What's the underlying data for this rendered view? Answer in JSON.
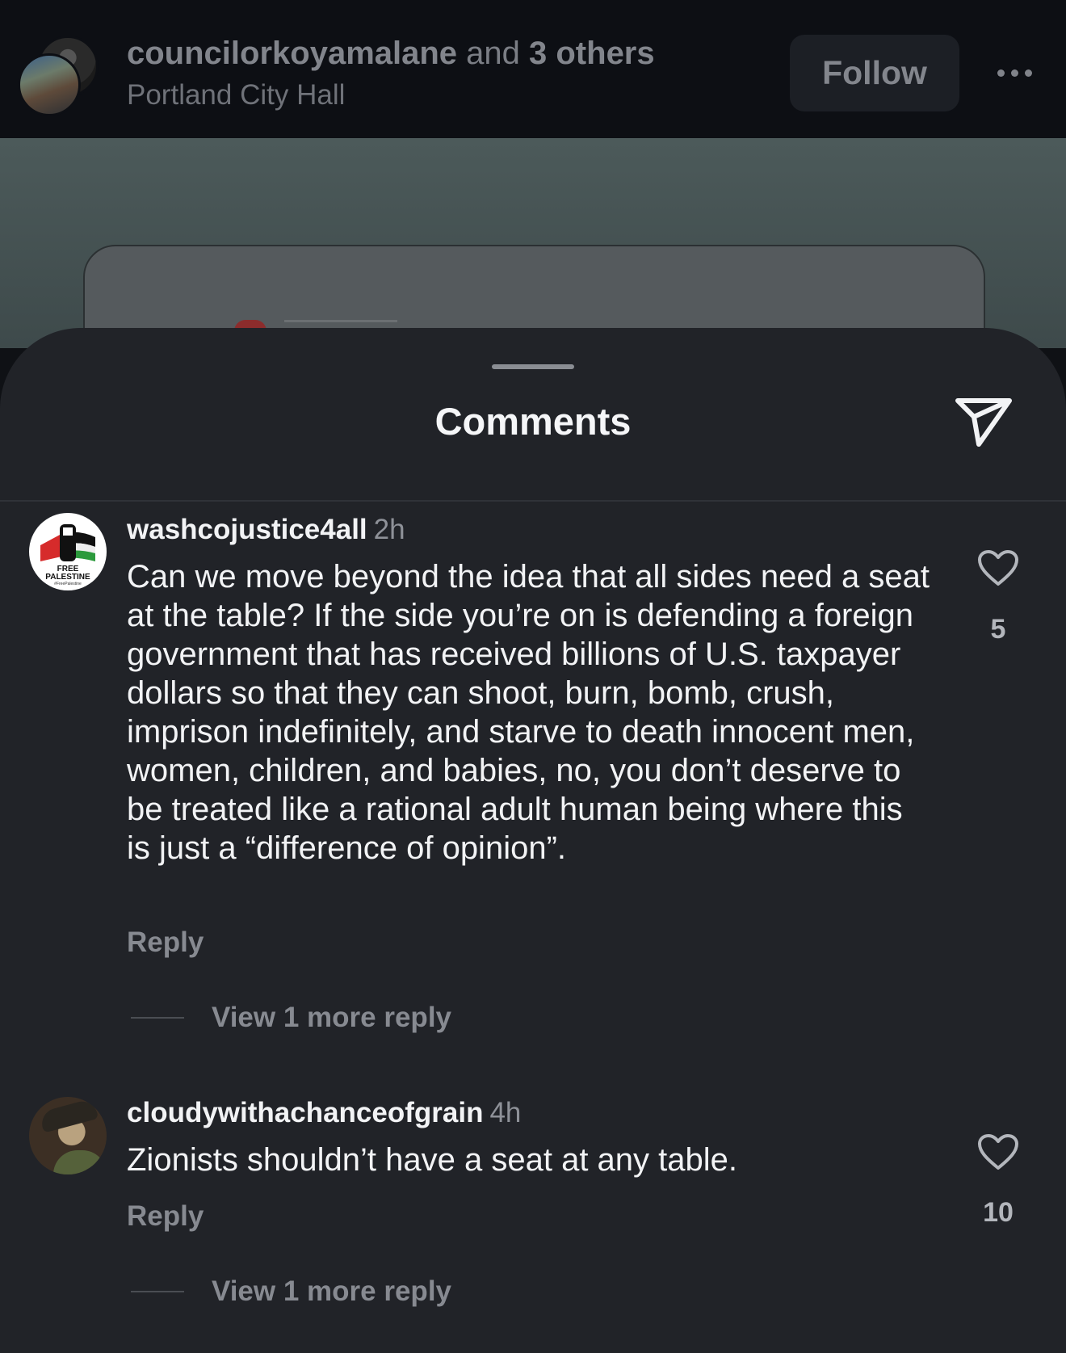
{
  "header": {
    "username": "councilorkoyamalane",
    "and_text": " and ",
    "others": "3 others",
    "location": "Portland City Hall",
    "follow_label": "Follow",
    "more_icon": "more-horizontal-icon"
  },
  "sheet": {
    "title": "Comments",
    "share_icon": "send-icon"
  },
  "comments": [
    {
      "username": "washcojustice4all",
      "time": "2h",
      "text": "Can we move beyond the idea that all sides need a seat at the table?  If the side you’re on is defending a foreign government that has received billions of U.S. taxpayer dollars so that they can shoot, burn, bomb, crush, imprison indefinitely, and starve to death innocent men, women, children, and babies, no, you don’t deserve to be treated like a rational adult human being where this is just a “difference of opinion”.",
      "reply_label": "Reply",
      "view_more": "View 1 more reply",
      "likes": "5",
      "avatar_text_1": "FREE",
      "avatar_text_2": "PALESTINE",
      "avatar_text_3": "#FreePalestine"
    },
    {
      "username": "cloudywithachanceofgrain",
      "time": "4h",
      "text": "Zionists shouldn’t have a seat at any table.",
      "reply_label": "Reply",
      "view_more": "View 1 more reply",
      "likes": "10"
    }
  ],
  "colors": {
    "background": "#212328",
    "header_bg": "#0d0f14",
    "text_primary": "#f2f3f5",
    "text_secondary": "#878a91"
  }
}
